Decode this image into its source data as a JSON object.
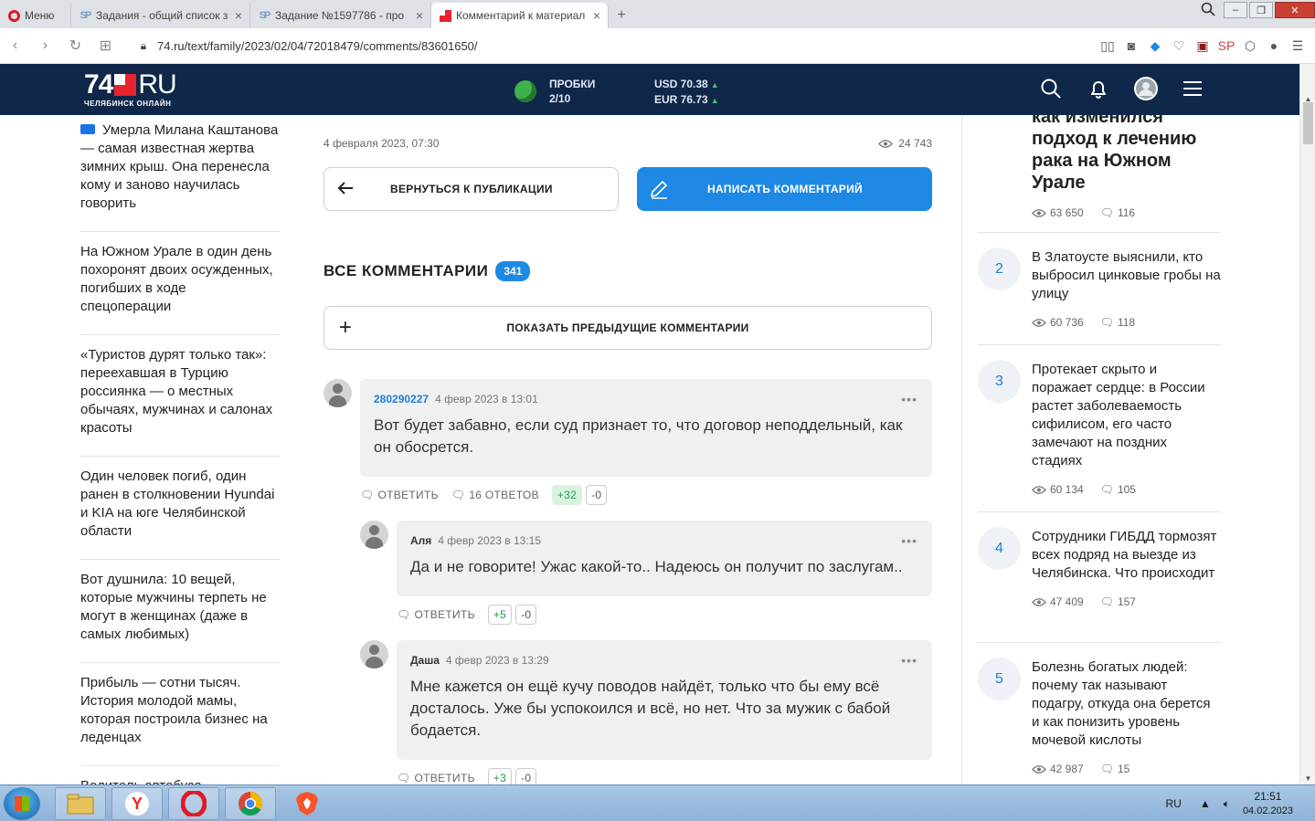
{
  "browser": {
    "menu_label": "Меню",
    "tabs": [
      {
        "title": "Задания - общий список з"
      },
      {
        "title": "Задание №1597786 - про"
      },
      {
        "title": "Комментарий к материал"
      }
    ],
    "url": "74.ru/text/family/2023/02/04/72018479/comments/83601650/"
  },
  "header": {
    "logo_big": "74",
    "logo_ru": "RU",
    "logo_small": "ЧЕЛЯБИНСК ОНЛАЙН",
    "traffic_label": "ПРОБКИ",
    "traffic_value": "2/10",
    "usd": "USD 70.38",
    "eur": "EUR 76.73"
  },
  "left_news": [
    {
      "title": "Умерла Милана Каштанова — самая известная жертва зимних крыш. Она перенесла кому и заново научилась говорить"
    },
    {
      "title": "На Южном Урале в один день похоронят двоих осужденных, погибших в ходе спецоперации"
    },
    {
      "title": "«Туристов дурят только так»: переехавшая в Турцию россиянка — о местных обычаях, мужчинах и салонах красоты"
    },
    {
      "title": "Один человек погиб, один ранен в столкновении Hyundai и KIA на юге Челябинской области"
    },
    {
      "title": "Вот душнила: 10 вещей, которые мужчины терпеть не могут в женщинах (даже в самых любимых)"
    },
    {
      "title": "Прибыль — сотни тысяч. История молодой мамы, которая построила бизнес на леденцах"
    },
    {
      "title": "Водитель автобуса"
    }
  ],
  "main": {
    "date": "4 февраля 2023, 07:30",
    "views": "24 743",
    "back_label": "ВЕРНУТЬСЯ К ПУБЛИКАЦИИ",
    "write_label": "НАПИСАТЬ КОММЕНТАРИЙ",
    "all_comments_label": "ВСЕ КОММЕНТАРИИ",
    "comments_count": "341",
    "show_prev_label": "ПОКАЗАТЬ ПРЕДЫДУЩИЕ КОММЕНТАРИИ",
    "reply_label": "ОТВЕТИТЬ",
    "dots": "•••",
    "comments": [
      {
        "author": "280290227",
        "time": "4 февр 2023 в 13:01",
        "text": "Вот будет забавно, если суд признает то, что договор неподдельный, как он обосрется.",
        "answers": "16 ОТВЕТОВ",
        "plus": "+32",
        "minus": "-0"
      },
      {
        "author": "Аля",
        "time": "4 февр 2023 в 13:15",
        "text": "Да и не говорите! Ужас какой-то.. Надеюсь он получит по заслугам..",
        "plus": "+5",
        "minus": "-0"
      },
      {
        "author": "Даша",
        "time": "4 февр 2023 в 13:29",
        "text": "Мне кажется он ещё кучу поводов найдёт, только что бы ему всё досталось. Уже бы успокоился и всё, но нет. Что за мужик с бабой бодается.",
        "plus": "+3",
        "minus": "-0"
      }
    ]
  },
  "right_news": {
    "top": {
      "title": "как изменился подход к лечению рака на Южном Урале",
      "views": "63 650",
      "comments": "116"
    },
    "items": [
      {
        "num": "2",
        "title": "В Златоусте выяснили, кто выбросил цинковые гробы на улицу",
        "views": "60 736",
        "comments": "118"
      },
      {
        "num": "3",
        "title": "Протекает скрыто и поражает сердце: в России растет заболеваемость сифилисом, его часто замечают на поздних стадиях",
        "views": "60 134",
        "comments": "105"
      },
      {
        "num": "4",
        "title": "Сотрудники ГИБДД тормозят всех подряд на выезде из Челябинска. Что происходит",
        "views": "47 409",
        "comments": "157"
      },
      {
        "num": "5",
        "title": "Болезнь богатых людей: почему так называют подагру, откуда она берется и как понизить уровень мочевой кислоты",
        "views": "42 987",
        "comments": "15"
      }
    ]
  },
  "taskbar": {
    "lang": "RU",
    "time": "21:51",
    "date": "04.02.2023"
  },
  "colors": {
    "header_bg": "#0f2748",
    "accent": "#1e88e5",
    "logo_red": "#e8232d",
    "vote_green": "#1f9e4f"
  }
}
